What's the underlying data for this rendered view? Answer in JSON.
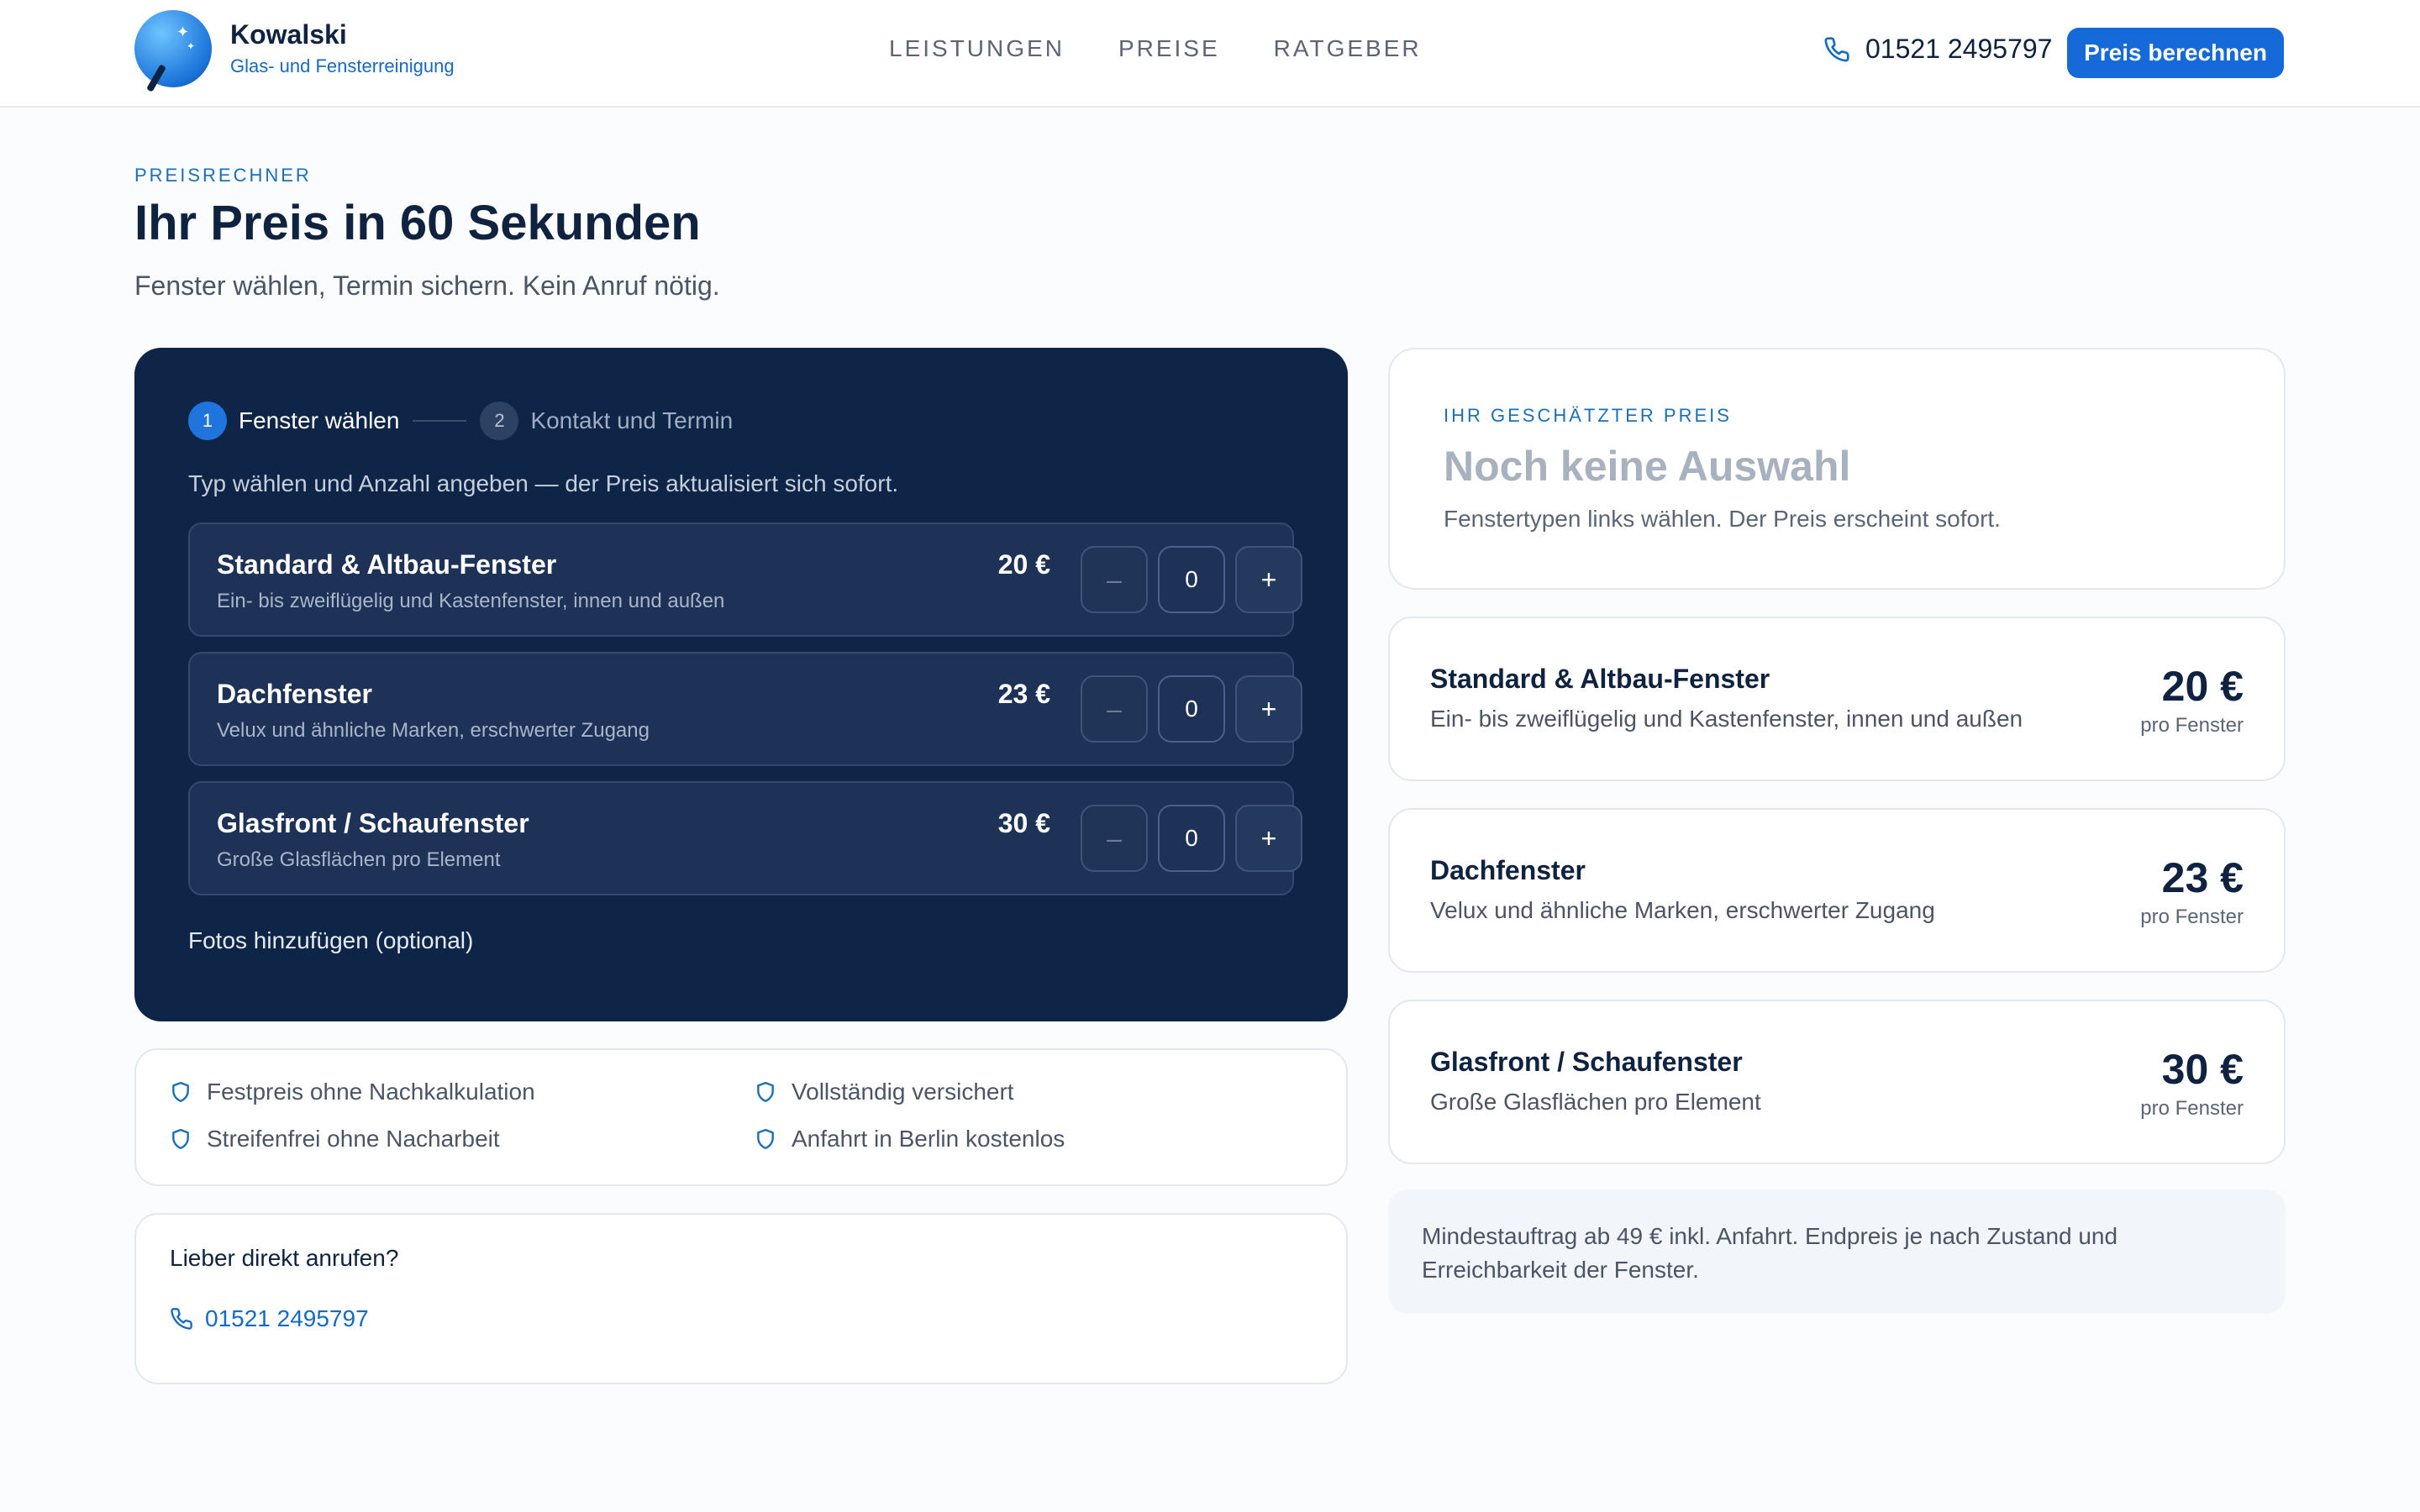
{
  "brand": {
    "name": "Kowalski",
    "subtitle": "Glas- und Fensterreinigung"
  },
  "nav": {
    "items": [
      {
        "label": "LEISTUNGEN"
      },
      {
        "label": "PREISE"
      },
      {
        "label": "RATGEBER"
      }
    ]
  },
  "header": {
    "phone": "01521 2495797",
    "cta_label": "Preis berechnen"
  },
  "intro": {
    "eyebrow": "PREISRECHNER",
    "title": "Ihr Preis in 60 Sekunden",
    "subtitle": "Fenster wählen, Termin sichern. Kein Anruf nötig."
  },
  "calculator": {
    "steps": [
      {
        "number": "1",
        "label": "Fenster wählen"
      },
      {
        "number": "2",
        "label": "Kontakt und Termin"
      }
    ],
    "hint": "Typ wählen und Anzahl angeben — der Preis aktualisiert sich sofort.",
    "items": [
      {
        "title": "Standard & Altbau-Fenster",
        "desc": "Ein- bis zweiflügelig und Kastenfenster, innen und außen",
        "price": "20 €",
        "qty": "0",
        "minus": "–",
        "plus": "+"
      },
      {
        "title": "Dachfenster",
        "desc": "Velux und ähnliche Marken, erschwerter Zugang",
        "price": "23 €",
        "qty": "0",
        "minus": "–",
        "plus": "+"
      },
      {
        "title": "Glasfront / Schaufenster",
        "desc": "Große Glasflächen pro Element",
        "price": "30 €",
        "qty": "0",
        "minus": "–",
        "plus": "+"
      }
    ],
    "photos_label": "Fotos hinzufügen (optional)"
  },
  "benefits": [
    "Festpreis ohne Nachkalkulation",
    "Vollständig versichert",
    "Streifenfrei ohne Nacharbeit",
    "Anfahrt in Berlin kostenlos"
  ],
  "call": {
    "title": "Lieber direkt anrufen?",
    "phone": "01521 2495797"
  },
  "estimate": {
    "eyebrow": "IHR GESCHÄTZTER PREIS",
    "title": "Noch keine Auswahl",
    "hint": "Fenstertypen links wählen. Der Preis erscheint sofort."
  },
  "price_cards": [
    {
      "title": "Standard & Altbau-Fenster",
      "desc": "Ein- bis zweiflügelig und Kastenfenster, innen und außen",
      "price": "20 €",
      "unit": "pro Fenster"
    },
    {
      "title": "Dachfenster",
      "desc": "Velux und ähnliche Marken, erschwerter Zugang",
      "price": "23 €",
      "unit": "pro Fenster"
    },
    {
      "title": "Glasfront / Schaufenster",
      "desc": "Große Glasflächen pro Element",
      "price": "30 €",
      "unit": "pro Fenster"
    }
  ],
  "note": "Mindestauftrag ab 49 € inkl. Anfahrt. Endpreis je nach Zustand und Erreichbarkeit der Fenster.",
  "colors": {
    "accent": "#1569d9",
    "panel": "#0f2547",
    "text": "#0f2340"
  }
}
